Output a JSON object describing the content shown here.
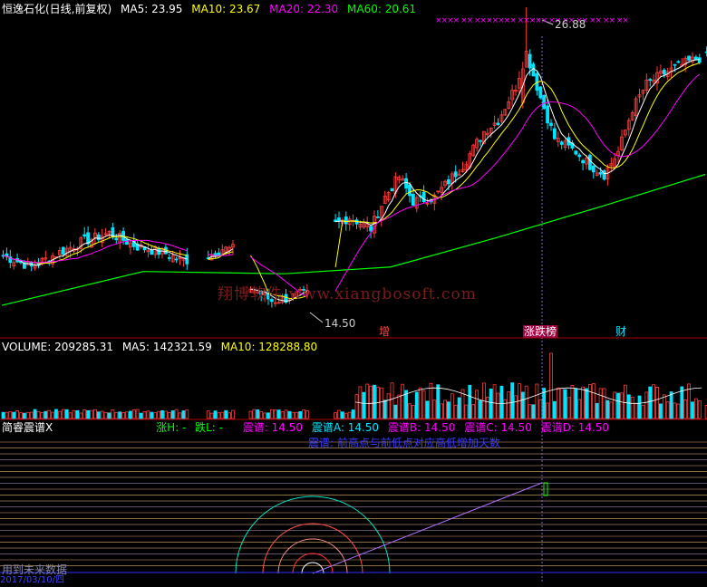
{
  "price_header": {
    "title": "恒逸石化(日线,前复权)",
    "ma5_label": "MA5: 23.95",
    "ma10_label": "MA10: 23.67",
    "ma20_label": "MA20: 22.30",
    "ma60_label": "MA60: 20.61"
  },
  "volume_header": {
    "volume_label": "VOLUME: 209285.31",
    "ma5_label": "MA5: 142321.59",
    "ma10_label": "MA10: 128288.80"
  },
  "indicator_header": {
    "name": "简睿震谱X",
    "zhang_h": "涨H: -",
    "die_l": "跌L: -",
    "zp": "震谱: 14.50",
    "zpa": "震谱A: 14.50",
    "zpb": "震谱B: 14.50",
    "zpc": "震谱C: 14.50",
    "zpd": "震谱D: 14.50"
  },
  "indicator_note": "震谱: 前高点与前低点对应高低增加天数",
  "bottom_text": "用到未来数据",
  "date_fragment": "2017/03/10/四",
  "watermark": "翔博软件 www.xiangbosoft.com",
  "markers": {
    "zeng": "增",
    "zhangdie": "涨跌榜",
    "cai": "财"
  },
  "top_marks": "××××  ××  ×××××××     ×××××     ××   ××   ××   ××   ××   ××",
  "colors": {
    "up": "#ff3c3c",
    "down": "#00e5ff",
    "ma5": "#ffffff",
    "ma10": "#ffff00",
    "ma20": "#ff00ff",
    "ma60": "#00ff00",
    "border": "#b00000"
  },
  "chart_data": {
    "type": "candlestick",
    "price_ylim": [
      13.4,
      27.6
    ],
    "high_annotation": {
      "label": "26.88",
      "value": 26.88
    },
    "low_annotation": {
      "label": "14.50",
      "value": 14.5
    },
    "series_summary": [
      {
        "name": "MA5",
        "last": 23.95
      },
      {
        "name": "MA10",
        "last": 23.67
      },
      {
        "name": "MA20",
        "last": 22.3
      },
      {
        "name": "MA60",
        "last": 20.61
      }
    ],
    "volume_last": 209285.31,
    "volume_ma5": 142321.59,
    "volume_ma10": 128288.8,
    "indicator_value": 14.5
  }
}
